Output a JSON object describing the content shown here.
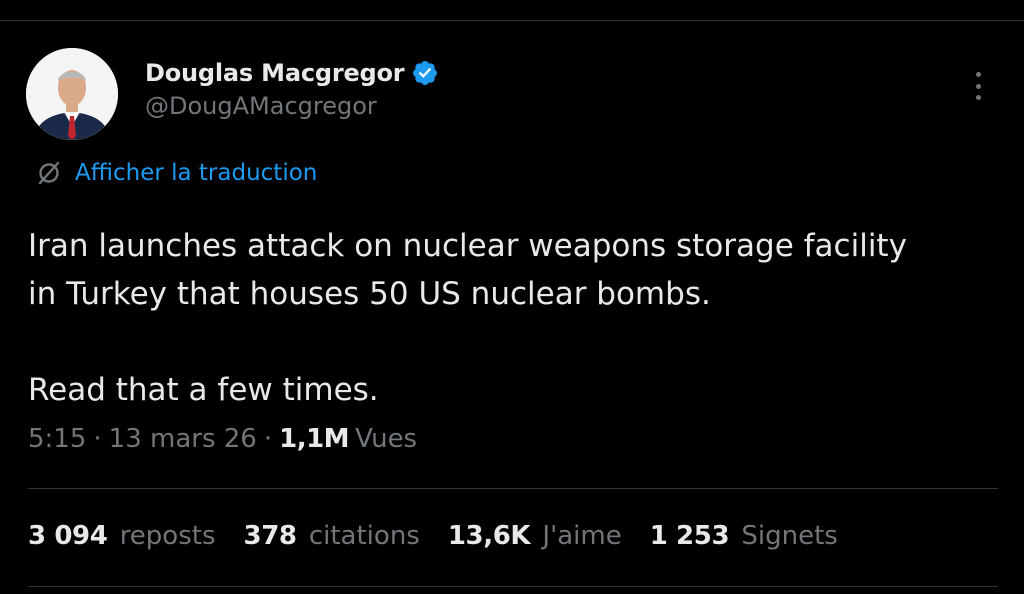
{
  "author": {
    "display_name": "Douglas Macgregor",
    "handle": "@DougAMacgregor",
    "verified": true,
    "verified_color": "#1d9bf0"
  },
  "translate": {
    "label": "Afficher la traduction",
    "icon": "translate-icon",
    "color": "#1d9bf0"
  },
  "tweet": {
    "text": "Iran launches attack on nuclear weapons storage facility\nin Turkey that houses 50 US nuclear bombs.\n\nRead that a few times."
  },
  "meta": {
    "time": "5:15",
    "date": "13 mars 26",
    "views_count": "1,1M",
    "views_label": "Vues"
  },
  "stats": [
    {
      "count": "3 094",
      "label": "reposts"
    },
    {
      "count": "378",
      "label": "citations"
    },
    {
      "count": "13,6K",
      "label": "J'aime"
    },
    {
      "count": "1 253",
      "label": "Signets"
    }
  ]
}
